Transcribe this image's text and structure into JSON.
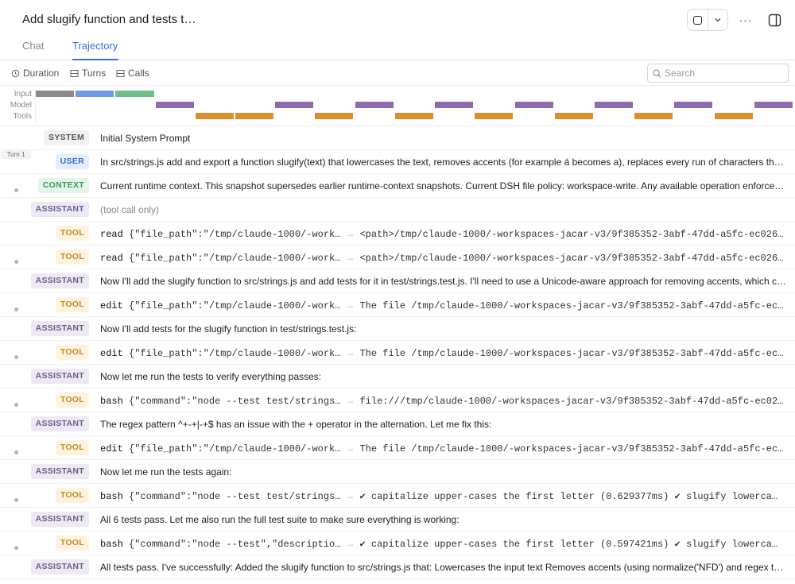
{
  "header": {
    "title": "Add slugify function and tests t…",
    "more_label": "···"
  },
  "tabs": [
    {
      "label": "Chat",
      "active": false
    },
    {
      "label": "Trajectory",
      "active": true
    }
  ],
  "toolbar": {
    "duration_label": "Duration",
    "turns_label": "Turns",
    "calls_label": "Calls",
    "search_placeholder": "Search"
  },
  "timeline": {
    "labels": [
      "Input",
      "Model",
      "Tools"
    ],
    "colors": {
      "input_a": "#8a8a8a",
      "input_b": "#6f9be6",
      "input_c": "#6dbf8a",
      "model": "#8c6bb1",
      "tools": "#de8e2a"
    }
  },
  "turn_label": "Turn 1",
  "rows": [
    {
      "role": "SYSTEM",
      "kind": "system",
      "text": "Initial System Prompt"
    },
    {
      "role": "USER",
      "kind": "user",
      "text": "In src/strings.js add and export a function slugify(text) that lowercases the text, removes accents (for example á becomes a), replaces every run of characters that is not a letter or a number with a single hyphen"
    },
    {
      "role": "CONTEXT",
      "kind": "context",
      "text": "Current runtime context. This snapshot supersedes earlier runtime-context snapshots. Current DSH file policy: workspace-write. Any available operation enforcement applies"
    },
    {
      "role": "ASSISTANT",
      "kind": "assistant",
      "text": "(tool call only)",
      "muted": true
    },
    {
      "role": "TOOL",
      "kind": "tool",
      "tool": "read",
      "args": "{\"file_path\":\"/tmp/claude-1000/-work…",
      "result": "<path>/tmp/claude-1000/-workspaces-jacar-v3/9f385352-3abf-47dd-a5fc-ec026…"
    },
    {
      "role": "TOOL",
      "kind": "tool",
      "tool": "read",
      "args": "{\"file_path\":\"/tmp/claude-1000/-work…",
      "result": "<path>/tmp/claude-1000/-workspaces-jacar-v3/9f385352-3abf-47dd-a5fc-ec026…"
    },
    {
      "role": "ASSISTANT",
      "kind": "assistant",
      "text": "Now I'll add the slugify function to src/strings.js and add tests for it in test/strings.test.js. I'll need to use a Unicode-aware approach for removing accents, which can be done with normalize"
    },
    {
      "role": "TOOL",
      "kind": "tool",
      "tool": "edit",
      "args": "{\"file_path\":\"/tmp/claude-1000/-work…",
      "result": "The file /tmp/claude-1000/-workspaces-jacar-v3/9f385352-3abf-47dd-a5fc-ec…"
    },
    {
      "role": "ASSISTANT",
      "kind": "assistant",
      "text": "Now I'll add tests for the slugify function in test/strings.test.js:"
    },
    {
      "role": "TOOL",
      "kind": "tool",
      "tool": "edit",
      "args": "{\"file_path\":\"/tmp/claude-1000/-work…",
      "result": "The file /tmp/claude-1000/-workspaces-jacar-v3/9f385352-3abf-47dd-a5fc-ec…"
    },
    {
      "role": "ASSISTANT",
      "kind": "assistant",
      "text": "Now let me run the tests to verify everything passes:"
    },
    {
      "role": "TOOL",
      "kind": "tool",
      "tool": "bash",
      "args": "{\"command\":\"node --test test/strings…",
      "result": "file:///tmp/claude-1000/-workspaces-jacar-v3/9f385352-3abf-47dd-a5fc-ec02…"
    },
    {
      "role": "ASSISTANT",
      "kind": "assistant",
      "text": "The regex pattern ^+-+|-+$ has an issue with the + operator in the alternation. Let me fix this:"
    },
    {
      "role": "TOOL",
      "kind": "tool",
      "tool": "edit",
      "args": "{\"file_path\":\"/tmp/claude-1000/-work…",
      "result": "The file /tmp/claude-1000/-workspaces-jacar-v3/9f385352-3abf-47dd-a5fc-ec…"
    },
    {
      "role": "ASSISTANT",
      "kind": "assistant",
      "text": "Now let me run the tests again:"
    },
    {
      "role": "TOOL",
      "kind": "tool",
      "tool": "bash",
      "args": "{\"command\":\"node --test test/strings…",
      "result": "✔ capitalize upper-cases the first letter (0.629377ms) ✔ slugify lowerca…"
    },
    {
      "role": "ASSISTANT",
      "kind": "assistant",
      "text": "All 6 tests pass. Let me also run the full test suite to make sure everything is working:"
    },
    {
      "role": "TOOL",
      "kind": "tool",
      "tool": "bash",
      "args": "{\"command\":\"node --test\",\"descriptio…",
      "result": "✔ capitalize upper-cases the first letter (0.597421ms) ✔ slugify lowerca…"
    },
    {
      "role": "ASSISTANT",
      "kind": "assistant",
      "text": "All tests pass. I've successfully: Added the slugify function to src/strings.js that: Lowercases the input text Removes accents (using normalize('NFD') and regex to strip diacritics)"
    }
  ]
}
